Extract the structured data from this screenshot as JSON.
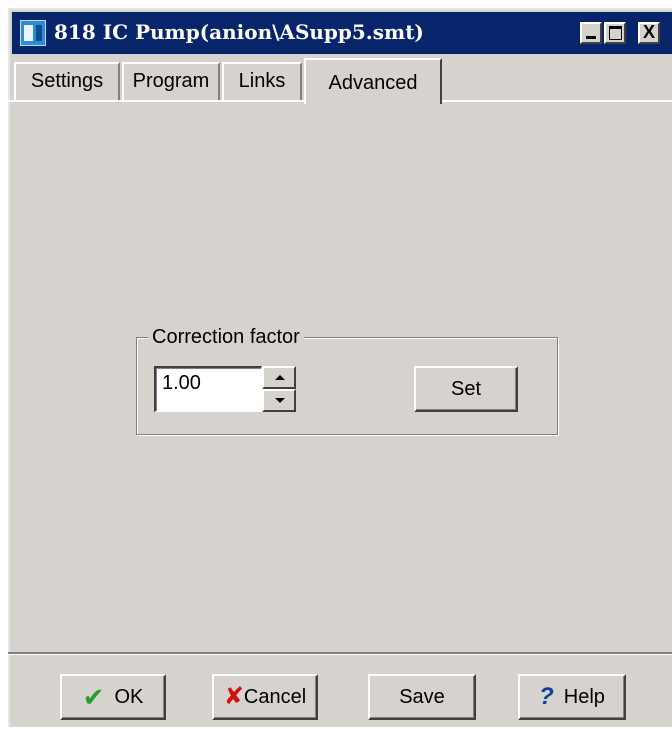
{
  "window": {
    "title": "818 IC Pump(anion\\ASupp5.smt)",
    "icon": "app-icon",
    "controls": {
      "minimize": "minimize-icon",
      "maximize": "maximize-icon",
      "close_label": "X"
    }
  },
  "tabs": [
    {
      "label": "Settings",
      "selected": false
    },
    {
      "label": "Program",
      "selected": false
    },
    {
      "label": "Links",
      "selected": false
    },
    {
      "label": "Advanced",
      "selected": true
    }
  ],
  "correction": {
    "group_label": "Correction factor",
    "value": "1.00",
    "set_label": "Set"
  },
  "footer": {
    "ok_label": "OK",
    "cancel_label": "Cancel",
    "save_label": "Save",
    "help_label": "Help",
    "ok_icon": "checkmark-icon",
    "cancel_icon": "x-mark-icon",
    "help_icon": "question-icon"
  },
  "colors": {
    "title_bar": "#08246b",
    "face": "#d6d3ce",
    "ok_check": "#2a9e27",
    "cancel_x": "#d11212",
    "help_mark": "#0b3fa8"
  }
}
